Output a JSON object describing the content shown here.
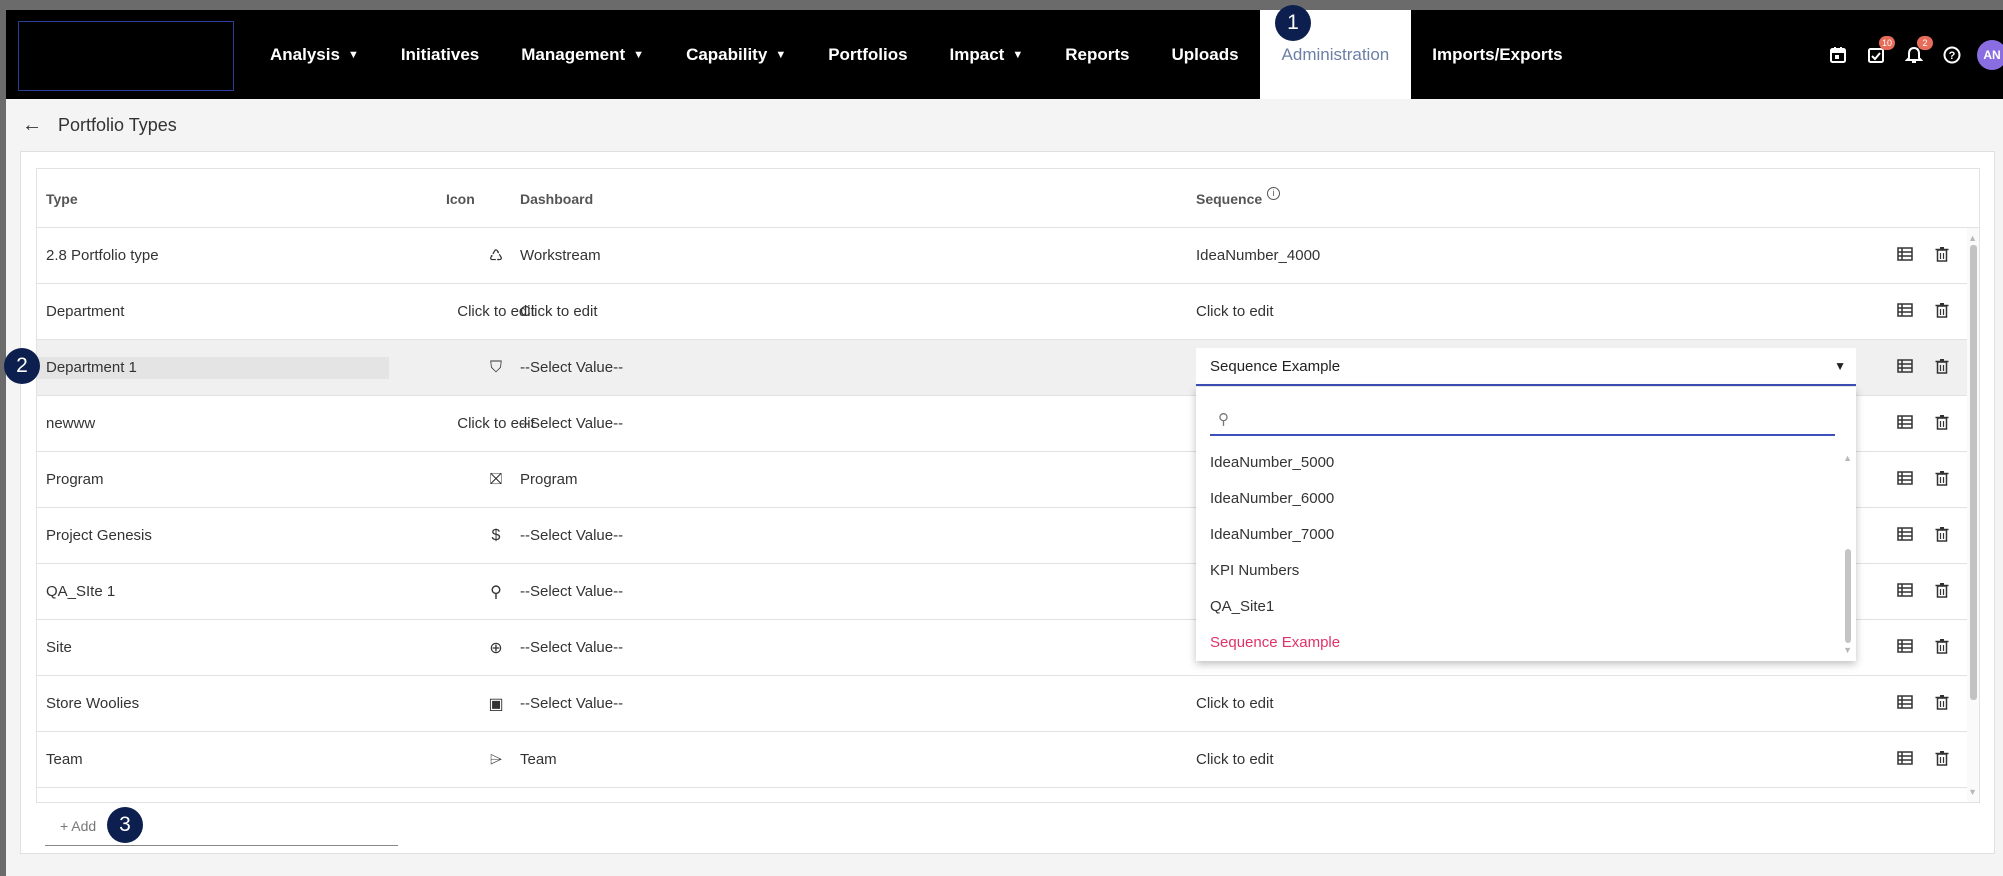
{
  "navbar": {
    "items": [
      {
        "label": "Analysis",
        "has_caret": true
      },
      {
        "label": "Initiatives",
        "has_caret": false
      },
      {
        "label": "Management",
        "has_caret": true
      },
      {
        "label": "Capability",
        "has_caret": true
      },
      {
        "label": "Portfolios",
        "has_caret": false
      },
      {
        "label": "Impact",
        "has_caret": true
      },
      {
        "label": "Reports",
        "has_caret": false
      },
      {
        "label": "Uploads",
        "has_caret": false
      },
      {
        "label": "Administration",
        "has_caret": false,
        "active": true
      },
      {
        "label": "Imports/Exports",
        "has_caret": false
      }
    ],
    "caret": "▼",
    "icons": {
      "calendar": "calendar-icon",
      "tasks": "tasks-icon",
      "tasks_badge": "10",
      "bell": "bell-icon",
      "bell_badge": "2",
      "help": "help-icon"
    },
    "avatar_initials": "AN"
  },
  "callouts": [
    "1",
    "2",
    "3"
  ],
  "page": {
    "title": "Portfolio Types",
    "back_icon": "back-arrow-icon"
  },
  "table": {
    "headers": {
      "type": "Type",
      "icon": "Icon",
      "dashboard": "Dashboard",
      "sequence": "Sequence"
    },
    "rows": [
      {
        "type": "2.8 Portfolio type",
        "icon": "piggy-bank-icon",
        "icon_glyph": "♺",
        "icon_text": "",
        "dashboard": "Workstream",
        "sequence": "IdeaNumber_4000"
      },
      {
        "type": "Department",
        "icon": "",
        "icon_glyph": "",
        "icon_text": "Click to edit",
        "dashboard": "Click to edit",
        "sequence": "Click to edit"
      },
      {
        "type": "Department 1",
        "icon": "shield-icon",
        "icon_glyph": "⛉",
        "icon_text": "",
        "dashboard": "--Select Value--",
        "sequence": "",
        "editing": true
      },
      {
        "type": "newww",
        "icon": "",
        "icon_glyph": "",
        "icon_text": "Click to edit",
        "dashboard": "--Select Value--",
        "sequence": ""
      },
      {
        "type": "Program",
        "icon": "bookmark-icon",
        "icon_glyph": "⛝",
        "icon_text": "",
        "dashboard": "Program",
        "sequence": ""
      },
      {
        "type": "Project Genesis",
        "icon": "dollar-chat-icon",
        "icon_glyph": "$",
        "icon_text": "",
        "dashboard": "--Select Value--",
        "sequence": ""
      },
      {
        "type": "QA_SIte 1",
        "icon": "hand-coin-icon",
        "icon_glyph": "⚲",
        "icon_text": "",
        "dashboard": "--Select Value--",
        "sequence": ""
      },
      {
        "type": "Site",
        "icon": "globe-icon",
        "icon_glyph": "⊕",
        "icon_text": "",
        "dashboard": "--Select Value--",
        "sequence": ""
      },
      {
        "type": "Store Woolies",
        "icon": "cash-icon",
        "icon_glyph": "▣",
        "icon_text": "",
        "dashboard": "--Select Value--",
        "sequence": "Click to edit"
      },
      {
        "type": "Team",
        "icon": "tag-icon",
        "icon_glyph": "⌲",
        "icon_text": "",
        "dashboard": "Team",
        "sequence": "Click to edit"
      }
    ],
    "row_actions": {
      "view": "table-view-icon",
      "delete": "trash-icon"
    }
  },
  "sequence_select": {
    "value": "Sequence Example",
    "search_placeholder": "",
    "options": [
      {
        "label": "IdeaNumber_5000",
        "selected": false
      },
      {
        "label": "IdeaNumber_6000",
        "selected": false
      },
      {
        "label": "IdeaNumber_7000",
        "selected": false
      },
      {
        "label": "KPI Numbers",
        "selected": false
      },
      {
        "label": "QA_Site1",
        "selected": false
      },
      {
        "label": "Sequence Example",
        "selected": true
      }
    ]
  },
  "add": {
    "label": "+ Add"
  },
  "colors": {
    "navbar_bg": "#000000",
    "active_tab_text": "#6c7fa6",
    "callout_bg": "#0d1f4f",
    "selected_option": "#e0336a",
    "focus_underline": "#3d4fb8",
    "badge": "#e76c5a",
    "avatar": "#8a6de0"
  }
}
